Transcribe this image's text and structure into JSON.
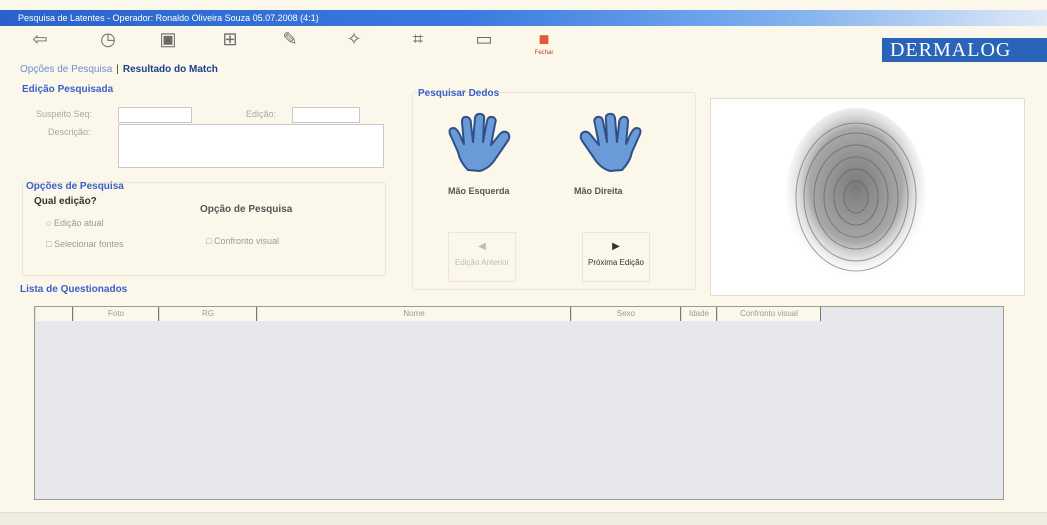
{
  "window": {
    "title": "Pesquisa de Latentes - Operador: Ronaldo Oliveira Souza 05.07.2008 (4:1)"
  },
  "toolbar": {
    "buttons": [
      {
        "icon": "back-arrow-icon",
        "glyph": "⇦"
      },
      {
        "icon": "history-icon",
        "glyph": "◷"
      },
      {
        "icon": "monitor-icon",
        "glyph": "▣"
      },
      {
        "icon": "network-icon",
        "glyph": "⊞"
      },
      {
        "icon": "pen-icon",
        "glyph": "✎"
      },
      {
        "icon": "tools-icon",
        "glyph": "✧"
      },
      {
        "icon": "brush-icon",
        "glyph": "⌗"
      },
      {
        "icon": "window-icon",
        "glyph": "▭"
      },
      {
        "icon": "close-app-icon",
        "glyph": "■",
        "label": "Fechar"
      }
    ]
  },
  "brand": "DERMALOG",
  "nav": {
    "tab1": "Opções de Pesquisa",
    "separator": "|",
    "tab2": "Resultado do Match"
  },
  "edicao": {
    "title": "Edição Pesquisada",
    "suspect_label": "Suspeito Seq:",
    "suspect_value": "",
    "edition_label": "Edição:",
    "edition_value": "",
    "description_label": "Descrição:",
    "description_value": ""
  },
  "opcoes": {
    "title": "Opções de Pesquisa",
    "which_label": "Qual edição?",
    "radio_current": "Edição atual",
    "radio_select": "Selecionar fontes",
    "search_option_label": "Opção de Pesquisa",
    "search_option_value": "Confronto visual"
  },
  "dedos": {
    "title": "Pesquisar Dedos",
    "left_hand": "Mão Esquerda",
    "right_hand": "Mão Direita",
    "prev_button": "Edição Anterior",
    "next_button": "Próxima Edição"
  },
  "lista": {
    "title": "Lista de Questionados",
    "columns": [
      "",
      "Foto",
      "RG",
      "Nome",
      "Sexo",
      "Idade",
      "Confronto visual"
    ]
  },
  "colors": {
    "accent": "#3a5fc8",
    "title_bar": "#2a62c9",
    "brand_bg": "#2a64b8",
    "hand_fill": "#6b9ad9"
  }
}
